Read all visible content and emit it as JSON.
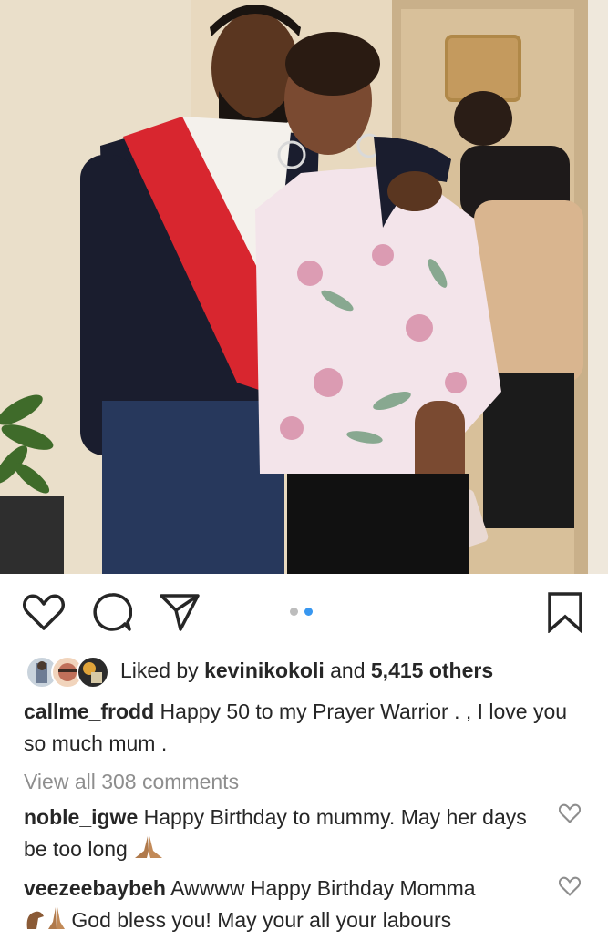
{
  "post": {
    "dots": {
      "count": 2,
      "active_index": 1
    }
  },
  "likes": {
    "prefix": "Liked by ",
    "user": "kevinikokoli",
    "middle": " and ",
    "others": "5,415 others"
  },
  "caption": {
    "username": "callme_frodd",
    "text": " Happy 50 to my Prayer Warrior . , I love you so much mum ."
  },
  "comments": {
    "view_all": "View all 308 comments",
    "items": [
      {
        "username": "noble_igwe",
        "text": " Happy Birthday to mummy. May her days be too long "
      },
      {
        "username": "veezeebaybeh",
        "text": " Awwww Happy Birthday Momma",
        "text2": " God bless you! May your all your labours"
      }
    ]
  },
  "icons": {
    "like": "heart-icon",
    "comment": "comment-icon",
    "share": "paper-plane-icon",
    "save": "bookmark-icon",
    "pray": "praying-hands-emoji",
    "flex": "flexed-arm-emoji"
  },
  "colors": {
    "accent": "#3897f0",
    "muted": "#8e8e8e",
    "text": "#262626"
  }
}
